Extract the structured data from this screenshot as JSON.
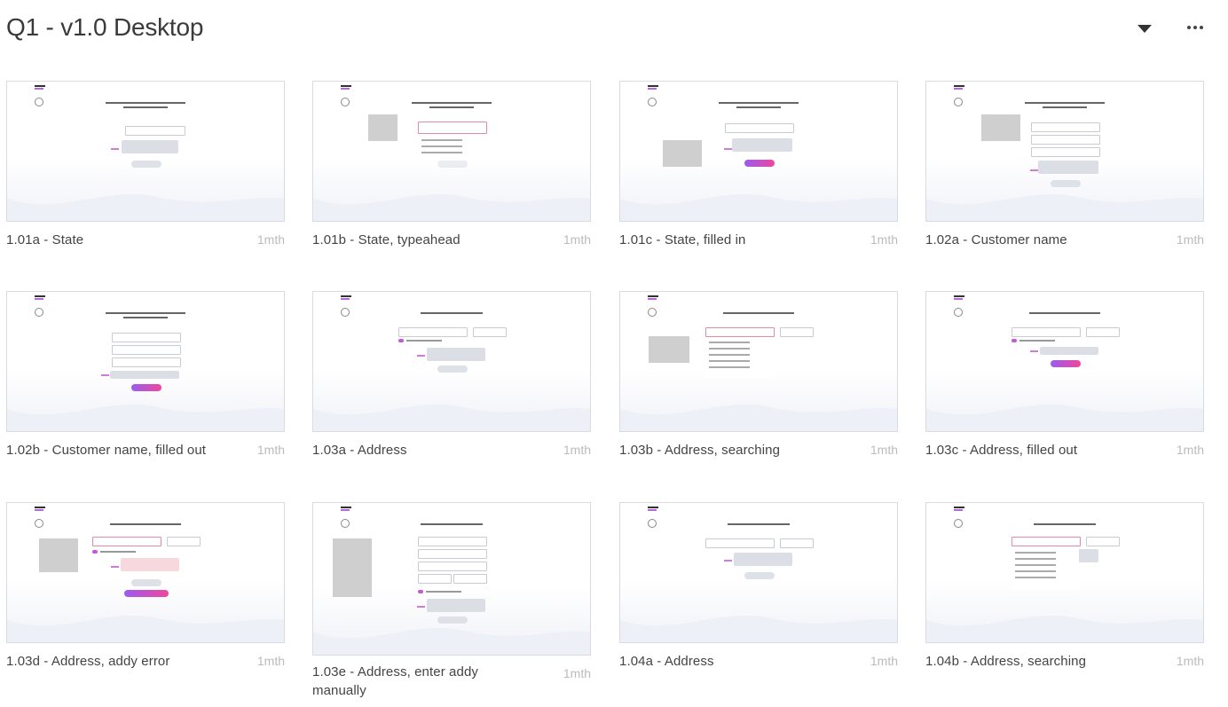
{
  "header": {
    "title": "Q1 - v1.0 Desktop"
  },
  "cards": [
    {
      "name": "1.01a - State",
      "age": "1mth"
    },
    {
      "name": "1.01b - State, typeahead",
      "age": "1mth"
    },
    {
      "name": "1.01c - State, filled in",
      "age": "1mth"
    },
    {
      "name": "1.02a - Customer name",
      "age": "1mth"
    },
    {
      "name": "1.02b - Customer name, filled out",
      "age": "1mth"
    },
    {
      "name": "1.03a - Address",
      "age": "1mth"
    },
    {
      "name": "1.03b - Address, searching",
      "age": "1mth"
    },
    {
      "name": "1.03c - Address, filled out",
      "age": "1mth"
    },
    {
      "name": "1.03d - Address, addy error",
      "age": "1mth"
    },
    {
      "name": "1.03e - Address, enter addy manually",
      "age": "1mth"
    },
    {
      "name": "1.04a - Address",
      "age": "1mth"
    },
    {
      "name": "1.04b - Address, searching",
      "age": "1mth"
    }
  ]
}
